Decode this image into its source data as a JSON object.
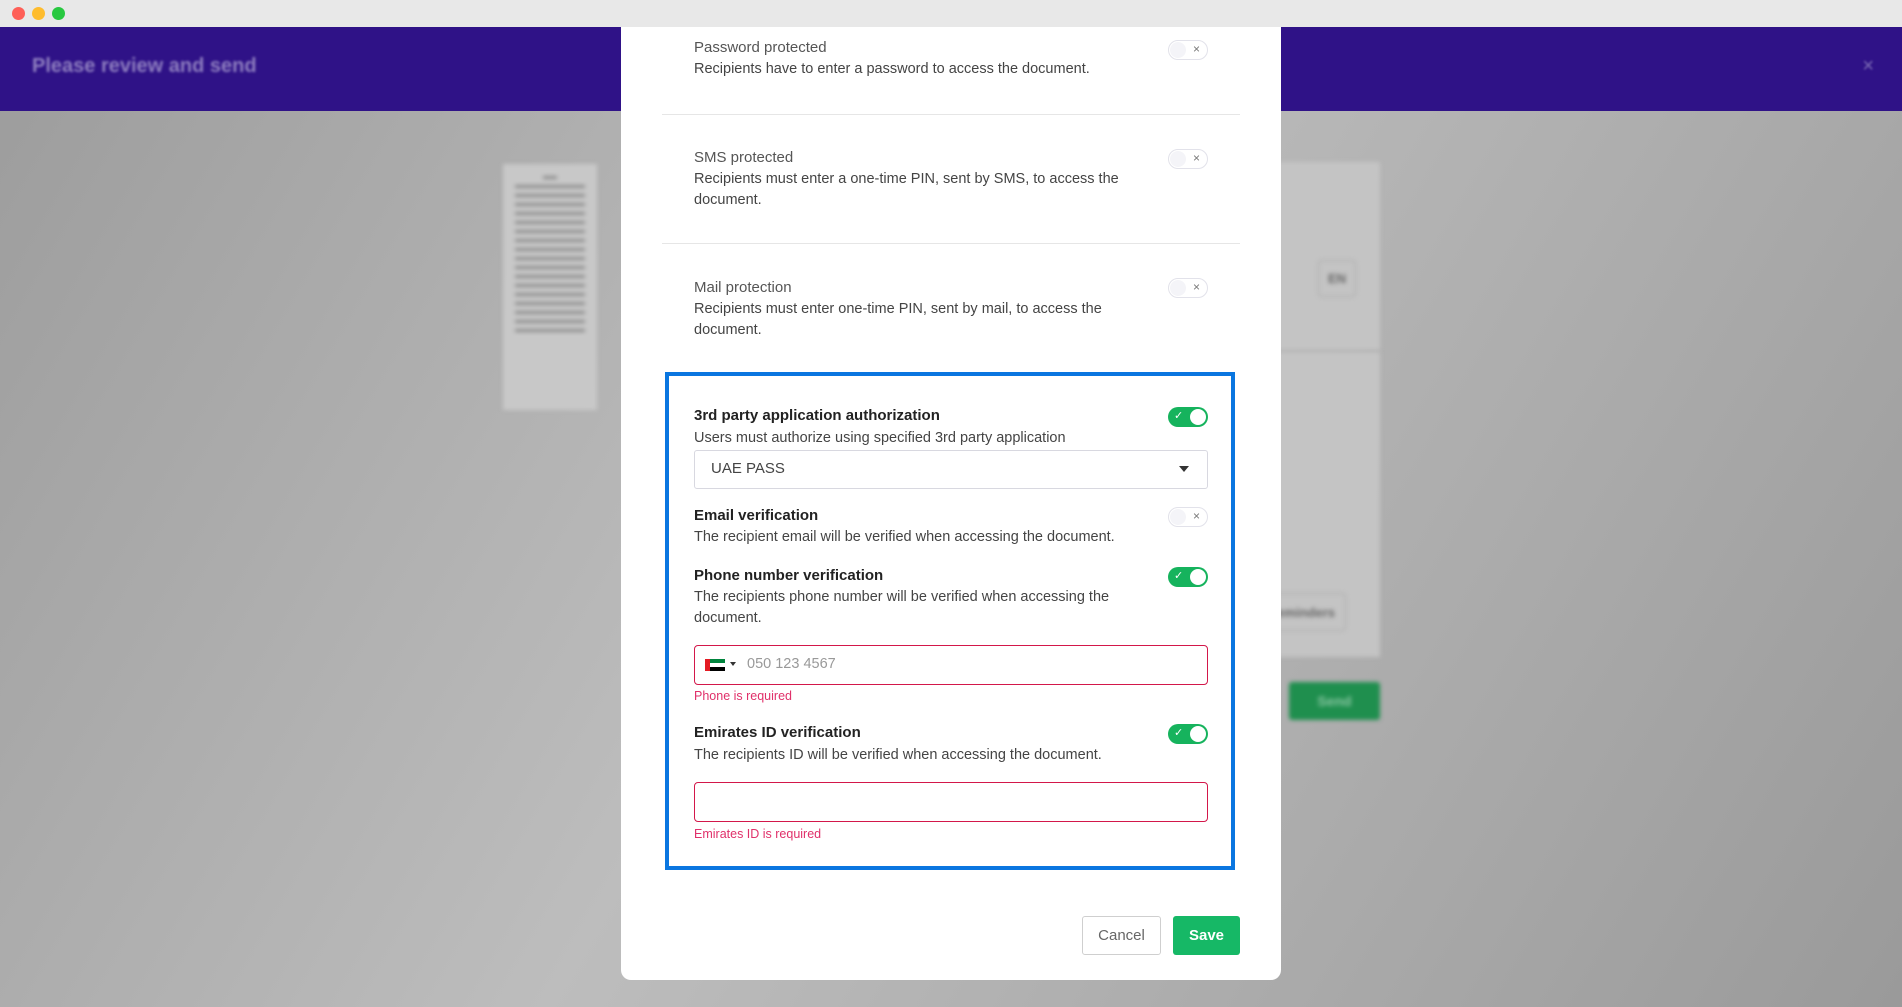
{
  "window": {
    "controls": {
      "close_color": "#fe5f57",
      "minimize_color": "#febc2e",
      "maximize_color": "#28c840"
    }
  },
  "background": {
    "header_title": "Please review and send",
    "close_icon": "×",
    "language_button": "EN",
    "reminders_button": "Reminders",
    "send_button": "Send"
  },
  "modal": {
    "options": [
      {
        "title": "Password protected",
        "description": "Recipients have to enter a password to access the document.",
        "enabled": false
      },
      {
        "title": "SMS protected",
        "description": "Recipients must enter a one-time PIN, sent by SMS, to access the document.",
        "enabled": false
      },
      {
        "title": "Mail protection",
        "description": "Recipients must enter one-time PIN, sent by mail, to access the document.",
        "enabled": false
      }
    ],
    "third_party": {
      "title": "3rd party application authorization",
      "description": "Users must authorize using specified 3rd party application",
      "enabled": true,
      "selected_app": "UAE PASS"
    },
    "email_verification": {
      "title": "Email verification",
      "description": "The recipient email will be verified when accessing the document.",
      "enabled": false
    },
    "phone_verification": {
      "title": "Phone number verification",
      "description": "The recipients phone number will be verified when accessing the document.",
      "enabled": true,
      "country": "AE",
      "placeholder": "050 123 4567",
      "value": "",
      "error": "Phone is required"
    },
    "emirates_id": {
      "title": "Emirates ID verification",
      "description": "The recipients ID will be verified when accessing the document.",
      "enabled": true,
      "value": "",
      "error": "Emirates ID is required"
    },
    "toggle_marks": {
      "on": "✓",
      "off": "×"
    },
    "cancel_label": "Cancel",
    "save_label": "Save",
    "colors": {
      "accent_green": "#16b35d",
      "error": "#d3174a",
      "highlight": "#0a76e0",
      "header": "#2f1287"
    }
  }
}
